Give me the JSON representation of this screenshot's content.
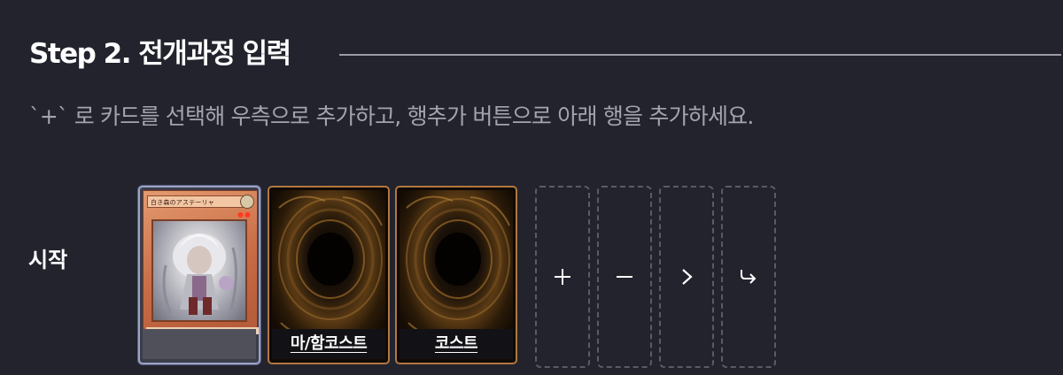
{
  "step": {
    "title": "Step 2. 전개과정 입력"
  },
  "instructions": "`+` 로 카드를 선택해 우측으로 추가하고, 행추가 버튼으로 아래 행을 추가하세요.",
  "row": {
    "label": "시작",
    "cards": [
      {
        "type": "monster",
        "name_text": "白き森のアステーリャ",
        "caption": ""
      },
      {
        "type": "card-back",
        "caption": "마/함코스트"
      },
      {
        "type": "card-back",
        "caption": "코스트"
      }
    ],
    "actions": [
      {
        "icon": "plus-icon",
        "symbol": "+"
      },
      {
        "icon": "minus-icon",
        "symbol": "−"
      },
      {
        "icon": "chevron-right-icon",
        "symbol": "›"
      },
      {
        "icon": "return-arrow-icon",
        "symbol": "↪"
      }
    ]
  },
  "colors": {
    "background": "#22232c",
    "muted_text": "#a3a4ad",
    "card_border_gold": "#b3773f",
    "selected_border": "#9aa3c8",
    "dashed_border": "#5a5b66"
  }
}
